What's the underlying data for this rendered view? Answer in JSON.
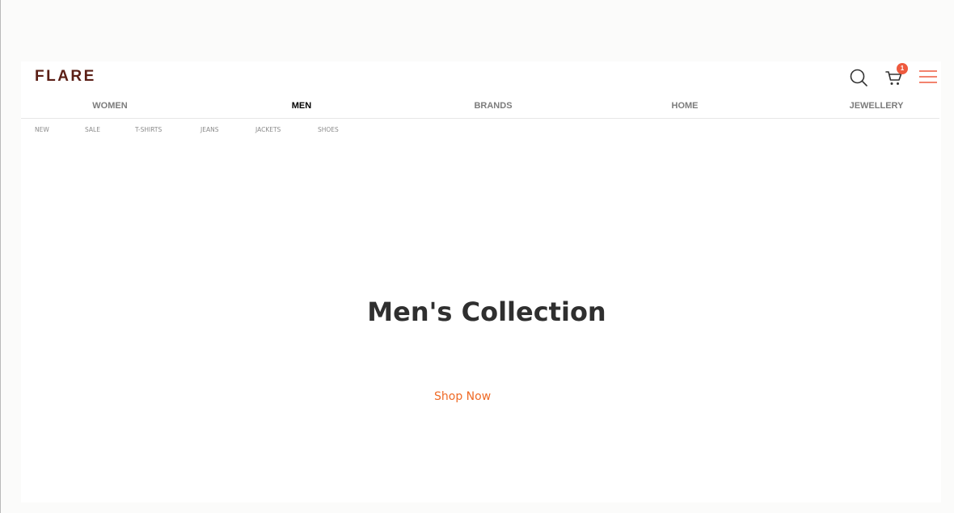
{
  "brand": {
    "logo_text": "FLARE"
  },
  "header": {
    "icons": [
      "search-icon",
      "cart-icon",
      "menu-icon"
    ],
    "cart_count": "1",
    "accent_color": "#ee5a3e"
  },
  "main_nav": {
    "items": [
      {
        "label": "WOMEN",
        "active": false
      },
      {
        "label": "MEN",
        "active": true
      },
      {
        "label": "BRANDS",
        "active": false
      },
      {
        "label": "HOME",
        "active": false
      },
      {
        "label": "JEWELLERY",
        "active": false
      }
    ]
  },
  "sub_nav": {
    "items": [
      {
        "label": "NEW"
      },
      {
        "label": "SALE"
      },
      {
        "label": "T-SHIRTS"
      },
      {
        "label": "JEANS"
      },
      {
        "label": "JACKETS"
      },
      {
        "label": "SHOES"
      }
    ]
  },
  "hero": {
    "title": "Men's Collection",
    "cta_label": "Shop Now",
    "cta_color": "#ef6a26"
  }
}
